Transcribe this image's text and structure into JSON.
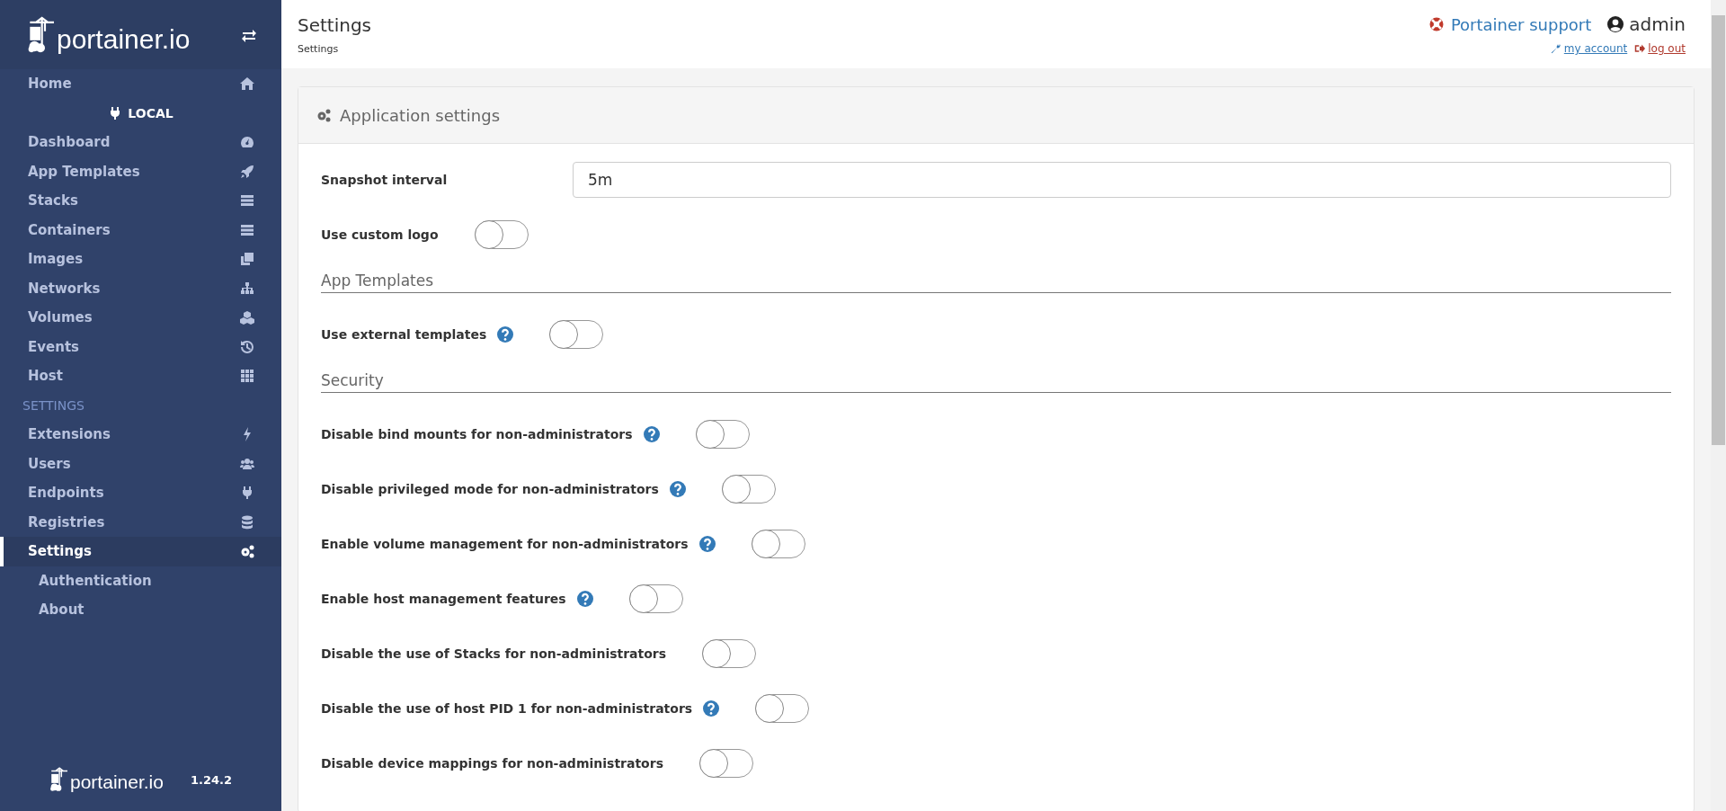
{
  "sidebar": {
    "logo": "portainer.io",
    "items": [
      {
        "label": "Home",
        "selected": false
      }
    ],
    "endpoint": "LOCAL",
    "endpoint_items": [
      {
        "label": "Dashboard",
        "selected": false
      },
      {
        "label": "App Templates",
        "selected": false
      },
      {
        "label": "Stacks",
        "selected": false
      },
      {
        "label": "Containers",
        "selected": false
      },
      {
        "label": "Images",
        "selected": false
      },
      {
        "label": "Networks",
        "selected": false
      },
      {
        "label": "Volumes",
        "selected": false
      },
      {
        "label": "Events",
        "selected": false
      },
      {
        "label": "Host",
        "selected": false
      }
    ],
    "section": "SETTINGS",
    "settings_items": [
      {
        "label": "Extensions",
        "selected": false
      },
      {
        "label": "Users",
        "selected": false
      },
      {
        "label": "Endpoints",
        "selected": false
      },
      {
        "label": "Registries",
        "selected": false
      },
      {
        "label": "Settings",
        "selected": true,
        "children": [
          {
            "label": "Authentication",
            "selected": false
          },
          {
            "label": "About",
            "selected": false
          }
        ]
      }
    ],
    "footer": {
      "logo": "portainer.io",
      "version": "1.24.2"
    }
  },
  "header": {
    "title": "Settings",
    "breadcrumb": "Settings",
    "support": "Portainer support",
    "user": "admin",
    "my_account": "my account",
    "log_out": "log out"
  },
  "panel": {
    "title": "Application settings",
    "rows": [
      {
        "kind": "input",
        "label": "Snapshot interval",
        "value": "5m"
      },
      {
        "kind": "toggle",
        "label": "Use custom logo",
        "help": false,
        "on": false
      },
      {
        "kind": "heading",
        "label": "App Templates"
      },
      {
        "kind": "toggle",
        "label": "Use external templates",
        "help": true,
        "on": false
      },
      {
        "kind": "heading",
        "label": "Security"
      },
      {
        "kind": "toggle",
        "label": "Disable bind mounts for non-administrators",
        "help": true,
        "on": false
      },
      {
        "kind": "toggle",
        "label": "Disable privileged mode for non-administrators",
        "help": true,
        "on": false
      },
      {
        "kind": "toggle",
        "label": "Enable volume management for non-administrators",
        "help": true,
        "on": false
      },
      {
        "kind": "toggle",
        "label": "Enable host management features",
        "help": true,
        "on": false
      },
      {
        "kind": "toggle",
        "label": "Disable the use of Stacks for non-administrators",
        "help": false,
        "on": false
      },
      {
        "kind": "toggle",
        "label": "Disable the use of host PID 1 for non-administrators",
        "help": true,
        "on": false
      },
      {
        "kind": "toggle",
        "label": "Disable device mappings for non-administrators",
        "help": false,
        "on": false
      }
    ]
  }
}
